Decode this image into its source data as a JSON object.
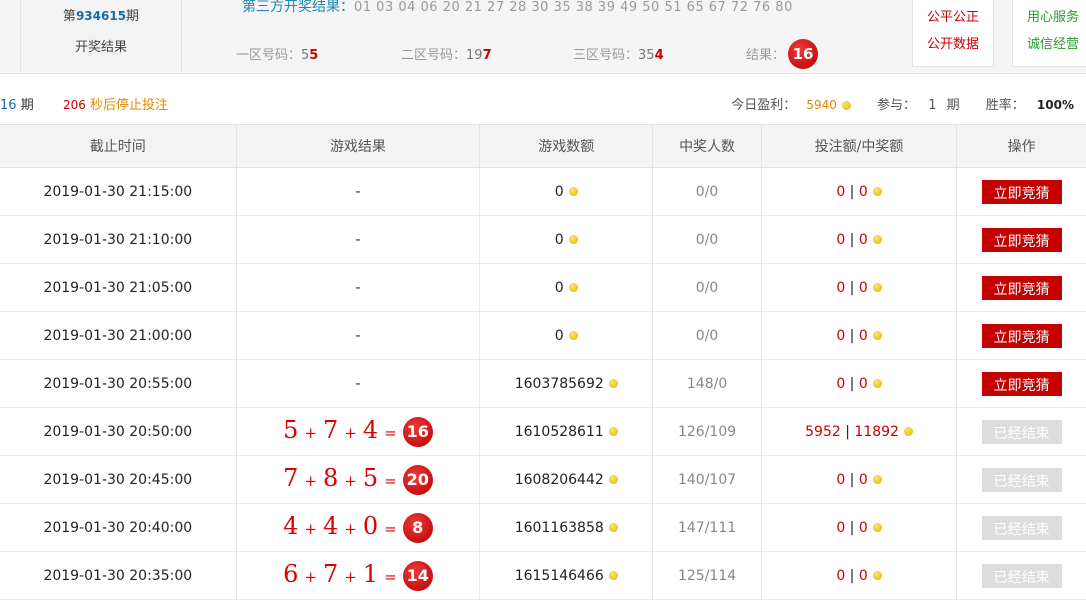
{
  "header": {
    "issue_prefix": "第",
    "issue_number": "934615",
    "issue_suffix": "期",
    "issue_label": "开奖结果",
    "third_party_label": "第三方开奖结果：",
    "third_party_numbers": "01 03 04 06 20 21 27 28 30 35 38 39 49 50 51 65 67 72 76 80",
    "zones": [
      {
        "label": "一区号码：",
        "pre": "5",
        "hl": "5"
      },
      {
        "label": "二区号码：",
        "pre": "19",
        "hl": "7"
      },
      {
        "label": "三区号码：",
        "pre": "35",
        "hl": "4"
      }
    ],
    "result_label": "结果：",
    "result_value": "16",
    "side1": [
      "公平公正",
      "公开数据"
    ],
    "side2": [
      "用心服务",
      "诚信经营"
    ]
  },
  "status_bar": {
    "period_number": "16",
    "period_suffix": "期",
    "countdown": "206",
    "countdown_suffix": "秒后停止投注",
    "profit_label": "今日盈利：",
    "profit_value": "5940",
    "join_label": "参与：",
    "join_value": "1",
    "join_suffix": "期",
    "winrate_label": "胜率：",
    "winrate_value": "100%"
  },
  "table": {
    "headers": [
      "截止时间",
      "游戏结果",
      "游戏数额",
      "中奖人数",
      "投注额/中奖额",
      "操作"
    ],
    "rows": [
      {
        "time": "2019-01-30 21:15:00",
        "result": "-",
        "amount": "0",
        "winners": "0/0",
        "bet": "0",
        "win": "0",
        "action": "立即竞猜",
        "done": false
      },
      {
        "time": "2019-01-30 21:10:00",
        "result": "-",
        "amount": "0",
        "winners": "0/0",
        "bet": "0",
        "win": "0",
        "action": "立即竞猜",
        "done": false
      },
      {
        "time": "2019-01-30 21:05:00",
        "result": "-",
        "amount": "0",
        "winners": "0/0",
        "bet": "0",
        "win": "0",
        "action": "立即竞猜",
        "done": false
      },
      {
        "time": "2019-01-30 21:00:00",
        "result": "-",
        "amount": "0",
        "winners": "0/0",
        "bet": "0",
        "win": "0",
        "action": "立即竞猜",
        "done": false
      },
      {
        "time": "2019-01-30 20:55:00",
        "result": "-",
        "amount": "1603785692",
        "winners": "148/0",
        "bet": "0",
        "win": "0",
        "action": "立即竞猜",
        "done": false
      },
      {
        "time": "2019-01-30 20:50:00",
        "a": "5",
        "b": "7",
        "c": "4",
        "sum": "16",
        "amount": "1610528611",
        "winners": "126/109",
        "bet": "5952",
        "win": "11892",
        "action": "已经结束",
        "done": true
      },
      {
        "time": "2019-01-30 20:45:00",
        "a": "7",
        "b": "8",
        "c": "5",
        "sum": "20",
        "amount": "1608206442",
        "winners": "140/107",
        "bet": "0",
        "win": "0",
        "action": "已经结束",
        "done": true
      },
      {
        "time": "2019-01-30 20:40:00",
        "a": "4",
        "b": "4",
        "c": "0",
        "sum": "8",
        "amount": "1601163858",
        "winners": "147/111",
        "bet": "0",
        "win": "0",
        "action": "已经结束",
        "done": true
      },
      {
        "time": "2019-01-30 20:35:00",
        "a": "6",
        "b": "7",
        "c": "1",
        "sum": "14",
        "amount": "1615146466",
        "winners": "125/114",
        "bet": "0",
        "win": "0",
        "action": "已经结束",
        "done": true
      }
    ]
  }
}
